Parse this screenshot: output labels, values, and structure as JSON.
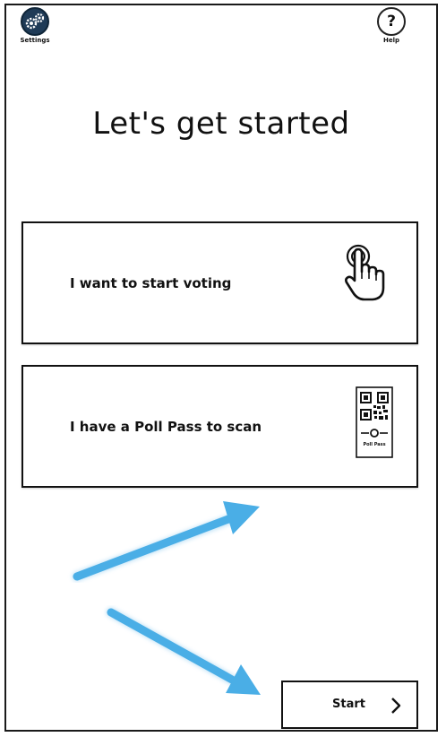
{
  "header": {
    "settings_label": "Settings",
    "help_label": "Help",
    "help_glyph": "?"
  },
  "main": {
    "title": "Let's get started",
    "options": [
      {
        "label": "I want to start voting",
        "icon": "hand-pointer-icon"
      },
      {
        "label": "I have a Poll Pass to scan",
        "icon": "poll-pass-qr-icon",
        "icon_caption": "Poll Pass"
      }
    ]
  },
  "footer": {
    "start_label": "Start",
    "start_icon": "chevron-right-icon"
  },
  "annotations": {
    "arrow_color": "#4aaee6",
    "arrow_icons": [
      "annotation-arrow-icon",
      "annotation-arrow-icon"
    ]
  },
  "colors": {
    "settings_icon_bg": "#1f3b57",
    "border": "#111111",
    "background": "#ffffff"
  }
}
